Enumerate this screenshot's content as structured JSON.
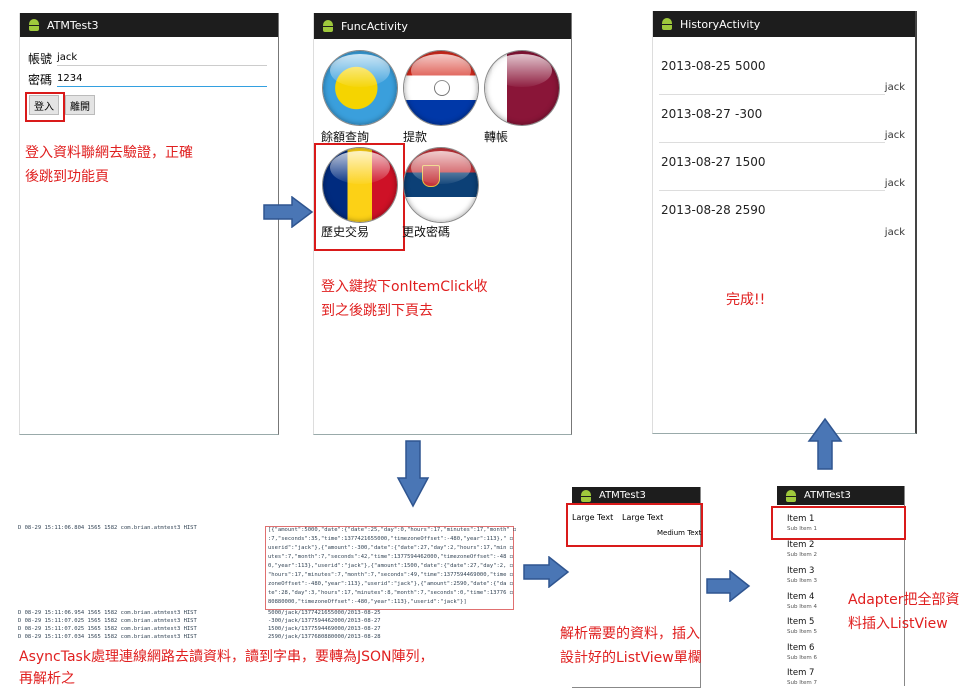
{
  "login_screen": {
    "title": "ATMTest3",
    "account_label": "帳號",
    "account_value": "jack",
    "password_label": "密碼",
    "password_value": "1234",
    "login_button": "登入",
    "exit_button": "離開",
    "note": [
      "登入資料聯網去驗證，正確",
      "後跳到功能頁"
    ]
  },
  "func_screen": {
    "title": "FuncActivity",
    "items": [
      "餘額查詢",
      "提款",
      "轉帳",
      "歷史交易",
      "更改密碼"
    ],
    "note": [
      "登入鍵按下onItemClick收",
      "到之後跳到下頁去"
    ]
  },
  "history_screen": {
    "title": "HistoryActivity",
    "rows": [
      {
        "date": "2013-08-25",
        "amount": "5000",
        "user": "jack"
      },
      {
        "date": "2013-08-27",
        "amount": "-300",
        "user": "jack"
      },
      {
        "date": "2013-08-27",
        "amount": "1500",
        "user": "jack"
      },
      {
        "date": "2013-08-28",
        "amount": "2590",
        "user": "jack"
      }
    ],
    "note": "完成!!"
  },
  "log_panel": {
    "top_rows": [
      "D   08-29 15:11:06.804   1565   1582   com.brian.atmtest3   HIST"
    ],
    "json_lines": [
      "[{\"amount\":5000,\"date\":{\"date\":25,\"day\":0,\"hours\":17,\"minutes\":17,\"month\" ◻",
      ":7,\"seconds\":35,\"time\":1377421655000,\"timezoneOffset\":-480,\"year\":113},\" ◻",
      "userid\":\"jack\"},{\"amount\":-300,\"date\":{\"date\":27,\"day\":2,\"hours\":17,\"min ◻",
      "utes\":7,\"month\":7,\"seconds\":42,\"time\":1377594462000,\"timezoneOffset\":-48 ◻",
      "0,\"year\":113},\"userid\":\"jack\"},{\"amount\":1500,\"date\":{\"date\":27,\"day\":2, ◻",
      "\"hours\":17,\"minutes\":7,\"month\":7,\"seconds\":49,\"time\":1377594469000,\"time ◻",
      "zoneOffset\":-480,\"year\":113},\"userid\":\"jack\"},{\"amount\":2590,\"date\":{\"da ◻",
      "te\":28,\"day\":3,\"hours\":17,\"minutes\":8,\"month\":7,\"seconds\":0,\"time\":13776 ◻",
      "80880000,\"timezoneOffset\":-480,\"year\":113},\"userid\":\"jack\"}]"
    ],
    "bottom_rows": [
      {
        "meta": "D   08-29 15:11:06.954   1565   1582   com.brian.atmtest3   HIST",
        "msg": "5000/jack/1377421655000/2013-08-25"
      },
      {
        "meta": "D   08-29 15:11:07.025   1565   1582   com.brian.atmtest3   HIST",
        "msg": "-300/jack/1377594462000/2013-08-27"
      },
      {
        "meta": "D   08-29 15:11:07.025   1565   1582   com.brian.atmtest3   HIST",
        "msg": "1500/jack/1377594469000/2013-08-27"
      },
      {
        "meta": "D   08-29 15:11:07.034   1565   1582   com.brian.atmtest3   HIST",
        "msg": "2590/jack/1377680880000/2013-08-28"
      }
    ],
    "note": [
      "AsyncTask處理連線網路去讀資料，讀到字串，要轉為JSON陣列，",
      "再解析之"
    ]
  },
  "row_layout": {
    "title": "ATMTest3",
    "large_text_1": "Large Text",
    "large_text_2": "Large Text",
    "medium_text": "Medium Text",
    "note": [
      "解析需要的資料，插入",
      "設計好的ListView單欄"
    ]
  },
  "list_screen": {
    "title": "ATMTest3",
    "items": [
      {
        "title": "Item 1",
        "sub": "Sub Item 1"
      },
      {
        "title": "Item 2",
        "sub": "Sub Item 2"
      },
      {
        "title": "Item 3",
        "sub": "Sub Item 3"
      },
      {
        "title": "Item 4",
        "sub": "Sub Item 4"
      },
      {
        "title": "Item 5",
        "sub": "Sub Item 5"
      },
      {
        "title": "Item 6",
        "sub": "Sub Item 6"
      },
      {
        "title": "Item 7",
        "sub": "Sub Item 7"
      }
    ],
    "note": [
      "Adapter把全部資",
      "料插入ListView"
    ]
  },
  "colors": {
    "note_red": "#e02020",
    "arrow_blue": "#4a76b5",
    "titlebar": "#1d1d1d"
  }
}
